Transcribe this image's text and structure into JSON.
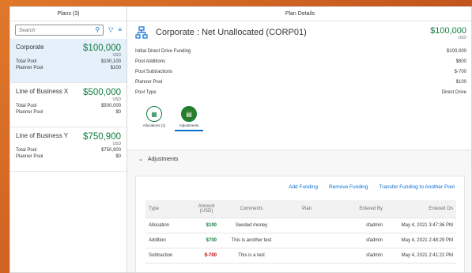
{
  "left": {
    "header": "Plans (3)",
    "search_placeholder": "Search",
    "plans": [
      {
        "name": "Corporate",
        "amount": "$100,000",
        "currency": "USD",
        "rows": [
          {
            "label": "Total Pool",
            "value": "$100,100"
          },
          {
            "label": "Planner Pool",
            "value": "$100"
          }
        ]
      },
      {
        "name": "Line of Business X",
        "amount": "$500,000",
        "currency": "USD",
        "rows": [
          {
            "label": "Total Pool",
            "value": "$500,000"
          },
          {
            "label": "Planner Pool",
            "value": "$0"
          }
        ]
      },
      {
        "name": "Line of Business Y",
        "amount": "$750,900",
        "currency": "USD",
        "rows": [
          {
            "label": "Total Pool",
            "value": "$750,900"
          },
          {
            "label": "Planner Pool",
            "value": "$0"
          }
        ]
      }
    ]
  },
  "right": {
    "header": "Plan Details",
    "title": "Corporate : Net Unallocated (CORP01)",
    "amount": "$100,000",
    "currency": "USD",
    "attributes": [
      {
        "label": "Initial Direct Drive Funding",
        "value": "$100,000"
      },
      {
        "label": "Pool Additions",
        "value": "$800"
      },
      {
        "label": "Pool Subtractions",
        "value": "$-700"
      },
      {
        "label": "Planner Pool",
        "value": "$100"
      },
      {
        "label": "Pool Type",
        "value": "Direct Drive"
      }
    ],
    "tabs": [
      {
        "label": "Allocations (1)"
      },
      {
        "label": "Adjustments"
      }
    ],
    "section_title": "Adjustments",
    "actions": {
      "add": "Add Funding",
      "remove": "Remove Funding",
      "transfer": "Transfer Funding to Another Pool"
    },
    "columns": {
      "type": "Type",
      "amount": "Amount (USD)",
      "comments": "Comments",
      "plan": "Plan",
      "entered_by": "Entered By",
      "entered_on": "Entered On"
    },
    "rows": [
      {
        "type": "Allocation",
        "amount": "$100",
        "comments": "Seeded money",
        "plan": "",
        "entered_by": "sfadmin",
        "entered_on": "May 4, 2021 3:47:36 PM"
      },
      {
        "type": "Addition",
        "amount": "$700",
        "comments": "This is another test",
        "plan": "",
        "entered_by": "sfadmin",
        "entered_on": "May 4, 2021 2:48:29 PM"
      },
      {
        "type": "Subtraction",
        "amount": "$-700",
        "comments": "This is a test",
        "plan": "",
        "entered_by": "sfadmin",
        "entered_on": "May 4, 2021 2:41:22 PM"
      }
    ]
  },
  "colors": {
    "positive": "#107e3e",
    "negative": "#bb0000",
    "link": "#0a6ed1",
    "selected": "#e5f0fa"
  },
  "icons": [
    "search-icon",
    "filter-icon",
    "settings-icon",
    "org-chart-icon",
    "chevron-down-icon"
  ]
}
